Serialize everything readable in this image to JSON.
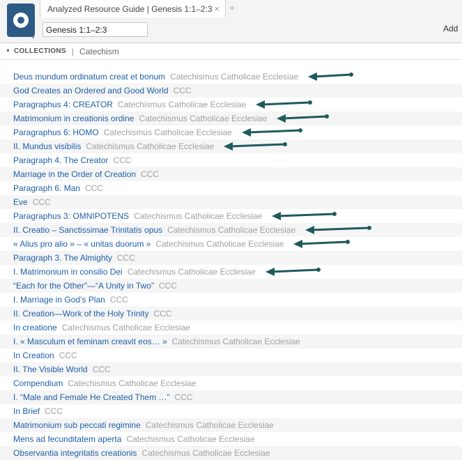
{
  "app": {
    "tab_title": "Analyzed Resource Guide | Genesis 1:1–2:3",
    "close_glyph": "×",
    "new_tab_glyph": "+",
    "reference_value": "Genesis 1:1–2:3",
    "add_label": "Add"
  },
  "collections": {
    "label": "COLLECTIONS",
    "separator": "|",
    "value": "Catechism"
  },
  "colors": {
    "link": "#1e5fa8",
    "source": "#a0a0a0",
    "logo": "#2d5a85",
    "annotation_arrow": "#1f5a5c"
  },
  "icons": {
    "app_logo": "logos-app-icon",
    "collapse": "caret-down-icon",
    "annotation": "arrow-annotation"
  },
  "results": [
    {
      "title": "Deus mundum ordinatum creat et bonum",
      "source": "Catechismus Catholicae Ecclesiae",
      "marked": true
    },
    {
      "title": "God Creates an Ordered and Good World",
      "source": "CCC",
      "marked": false
    },
    {
      "title": "Paragraphus 4: CREATOR",
      "source": "Catechismus Catholicae Ecclesiae",
      "marked": true
    },
    {
      "title": "Matrimonium in creationis ordine",
      "source": "Catechismus Catholicae Ecclesiae",
      "marked": true
    },
    {
      "title": "Paragraphus 6: HOMO",
      "source": "Catechismus Catholicae Ecclesiae",
      "marked": true
    },
    {
      "title": "II. Mundus visibilis",
      "source": "Catechismus Catholicae Ecclesiae",
      "marked": true
    },
    {
      "title": "Paragraph 4. The Creator",
      "source": "CCC",
      "marked": false
    },
    {
      "title": "Marriage in the Order of Creation",
      "source": "CCC",
      "marked": false
    },
    {
      "title": "Paragraph 6. Man",
      "source": "CCC",
      "marked": false
    },
    {
      "title": "Eve",
      "source": "CCC",
      "marked": false
    },
    {
      "title": "Paragraphus 3: OMNIPOTENS",
      "source": "Catechismus Catholicae Ecclesiae",
      "marked": true
    },
    {
      "title": "II. Creatio – Sanctissimae Trinitatis opus",
      "source": "Catechismus Catholicae Ecclesiae",
      "marked": true
    },
    {
      "title": "« Alius pro alio » – « unitas duorum »",
      "source": "Catechismus Catholicae Ecclesiae",
      "marked": true
    },
    {
      "title": "Paragraph 3. The Almighty",
      "source": "CCC",
      "marked": false
    },
    {
      "title": "I. Matrimonium in consilio Dei",
      "source": "Catechismus Catholicae Ecclesiae",
      "marked": true
    },
    {
      "title": "“Each for the Other”—“A Unity in Two”",
      "source": "CCC",
      "marked": false
    },
    {
      "title": "I. Marriage in God’s Plan",
      "source": "CCC",
      "marked": false
    },
    {
      "title": "II. Creation—Work of the Holy Trinity",
      "source": "CCC",
      "marked": false
    },
    {
      "title": "In creatione",
      "source": "Catechismus Catholicae Ecclesiae",
      "marked": false
    },
    {
      "title": "I. « Masculum et feminam creavit eos… »",
      "source": "Catechismus Catholicae Ecclesiae",
      "marked": false
    },
    {
      "title": "In Creation",
      "source": "CCC",
      "marked": false
    },
    {
      "title": "II. The Visible World",
      "source": "CCC",
      "marked": false
    },
    {
      "title": "Compendium",
      "source": "Catechismus Catholicae Ecclesiae",
      "marked": false
    },
    {
      "title": "I. “Male and Female He Created Them …”",
      "source": "CCC",
      "marked": false
    },
    {
      "title": "In Brief",
      "source": "CCC",
      "marked": false
    },
    {
      "title": "Matrimonium sub peccati regimine",
      "source": "Catechismus Catholicae Ecclesiae",
      "marked": false
    },
    {
      "title": "Mens ad fecunditatem aperta",
      "source": "Catechismus Catholicae Ecclesiae",
      "marked": false
    },
    {
      "title": "Observantia integritatis creationis",
      "source": "Catechismus Catholicae Ecclesiae",
      "marked": false
    }
  ]
}
